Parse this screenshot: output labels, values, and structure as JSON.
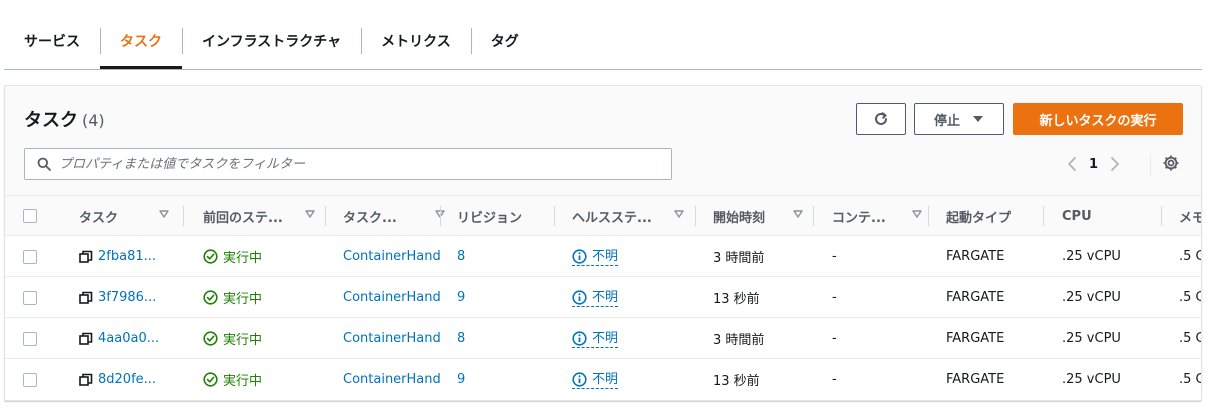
{
  "tabs": [
    "サービス",
    "タスク",
    "インフラストラクチャ",
    "メトリクス",
    "タグ"
  ],
  "active_tab_index": 1,
  "panel": {
    "title": "タスク",
    "count": "(4)"
  },
  "buttons": {
    "stop_label": "停止",
    "primary_label": "新しいタスクの実行"
  },
  "search": {
    "placeholder": "プロパティまたは値でタスクをフィルター"
  },
  "pagination": {
    "page": "1"
  },
  "columns": [
    "タスク",
    "前回のステ...",
    "タスク...",
    "リビジョン",
    "ヘルスステ...",
    "開始時刻",
    "コンテ...",
    "起動タイプ",
    "CPU",
    "メモ"
  ],
  "rows": [
    {
      "task": "2fba81...",
      "last_status": "実行中",
      "task_def": "ContainerHand",
      "revision": "8",
      "health": "不明",
      "started": "3 時間前",
      "container": "-",
      "launch_type": "FARGATE",
      "cpu": ".25 vCPU",
      "memory": ".5 G"
    },
    {
      "task": "3f7986...",
      "last_status": "実行中",
      "task_def": "ContainerHand",
      "revision": "9",
      "health": "不明",
      "started": "13 秒前",
      "container": "-",
      "launch_type": "FARGATE",
      "cpu": ".25 vCPU",
      "memory": ".5 G"
    },
    {
      "task": "4aa0a0...",
      "last_status": "実行中",
      "task_def": "ContainerHand",
      "revision": "8",
      "health": "不明",
      "started": "3 時間前",
      "container": "-",
      "launch_type": "FARGATE",
      "cpu": ".25 vCPU",
      "memory": ".5 G"
    },
    {
      "task": "8d20fe...",
      "last_status": "実行中",
      "task_def": "ContainerHand",
      "revision": "9",
      "health": "不明",
      "started": "13 秒前",
      "container": "-",
      "launch_type": "FARGATE",
      "cpu": ".25 vCPU",
      "memory": ".5 G"
    }
  ],
  "colors": {
    "accent": "#ec7211",
    "link": "#0073bb",
    "success": "#1d8102",
    "text": "#16191f",
    "secondary_text": "#545b64"
  },
  "icons": {
    "refresh": "refresh-icon",
    "stop_dropdown": "caret-down-icon",
    "search": "search-icon",
    "prev_page": "chevron-left-icon",
    "next_page": "chevron-right-icon",
    "settings": "gear-icon",
    "sort": "sort-caret-icon",
    "task_link": "copy-icon",
    "running": "check-circle-icon",
    "health_unknown": "info-circle-icon"
  }
}
